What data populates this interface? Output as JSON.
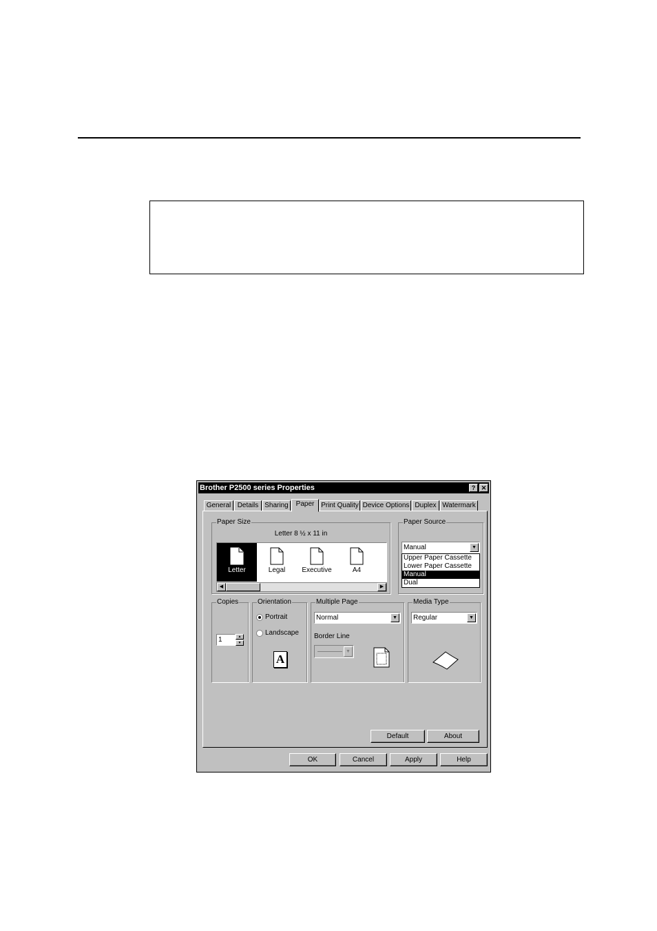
{
  "dialog": {
    "title": "Brother P2500 series Properties",
    "help_btn": "?",
    "close_btn": "✕",
    "tabs": [
      {
        "label": "General"
      },
      {
        "label": "Details"
      },
      {
        "label": "Sharing"
      },
      {
        "label": "Paper",
        "active": true
      },
      {
        "label": "Print Quality"
      },
      {
        "label": "Device Options"
      },
      {
        "label": "Duplex"
      },
      {
        "label": "Watermark"
      }
    ],
    "paper_size": {
      "label": "Paper Size",
      "current": "Letter 8 ½ x 11 in",
      "items": [
        {
          "label": "Letter",
          "selected": true
        },
        {
          "label": "Legal"
        },
        {
          "label": "Executive"
        },
        {
          "label": "A4"
        }
      ]
    },
    "paper_source": {
      "label": "Paper Source",
      "value": "Manual",
      "options": [
        "Upper Paper Cassette",
        "Lower Paper Cassette",
        "Manual",
        "Dual"
      ],
      "selected_option": "Manual"
    },
    "copies": {
      "label": "Copies",
      "value": "1"
    },
    "orientation": {
      "label": "Orientation",
      "portrait": "Portrait",
      "landscape": "Landscape",
      "selected": "Portrait",
      "preview_glyph": "A"
    },
    "multiple_page": {
      "label": "Multiple Page",
      "value": "Normal",
      "border_line_label": "Border Line"
    },
    "media_type": {
      "label": "Media Type",
      "value": "Regular"
    },
    "buttons": {
      "default": "Default",
      "about": "About",
      "ok": "OK",
      "cancel": "Cancel",
      "apply": "Apply",
      "help": "Help"
    }
  }
}
